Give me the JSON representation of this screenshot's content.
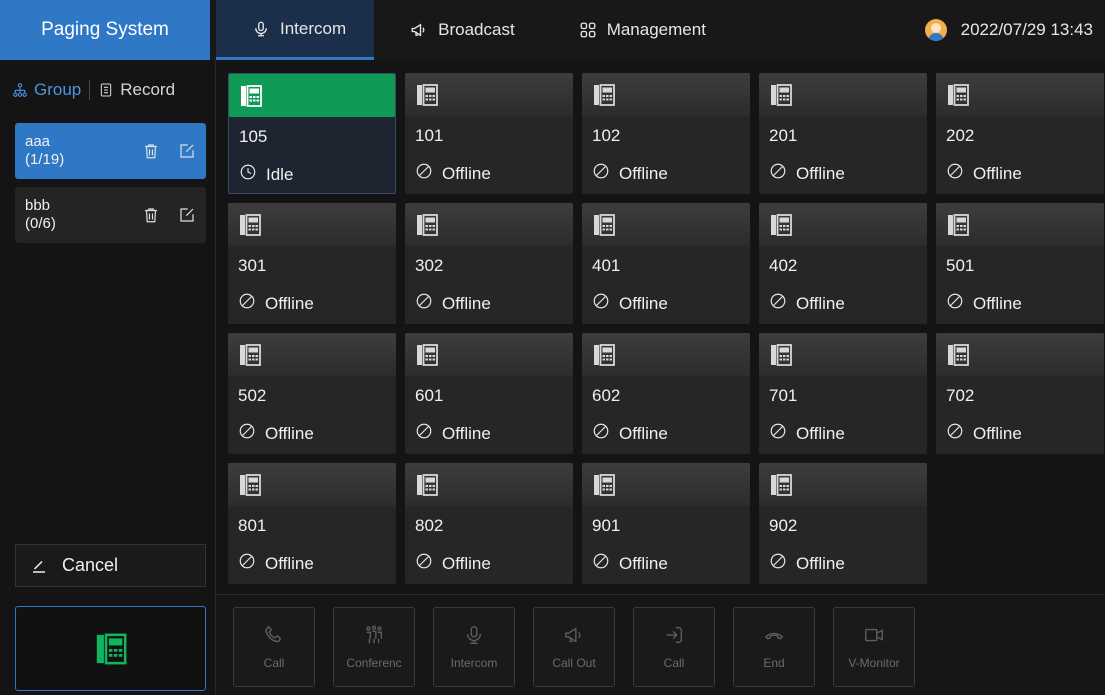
{
  "app": {
    "title": "Paging System"
  },
  "nav": {
    "tabs": [
      {
        "label": "Intercom",
        "icon": "microphone-icon",
        "active": true
      },
      {
        "label": "Broadcast",
        "icon": "megaphone-icon",
        "active": false
      },
      {
        "label": "Management",
        "icon": "grid-icon",
        "active": false
      }
    ]
  },
  "header": {
    "datetime": "2022/07/29 13:43",
    "avatar_icon": "user-avatar-icon"
  },
  "sidebar": {
    "tabs": [
      {
        "label": "Group",
        "icon": "org-chart-icon",
        "active": true
      },
      {
        "label": "Record",
        "icon": "record-list-icon",
        "active": false
      }
    ],
    "groups": [
      {
        "name": "aaa",
        "count": "(1/19)",
        "active": true
      },
      {
        "name": "bbb",
        "count": "(0/6)",
        "active": false
      }
    ],
    "cancel_label": "Cancel"
  },
  "devices": [
    {
      "number": "105",
      "status": "Idle",
      "state": "idle"
    },
    {
      "number": "101",
      "status": "Offline",
      "state": "offline"
    },
    {
      "number": "102",
      "status": "Offline",
      "state": "offline"
    },
    {
      "number": "201",
      "status": "Offline",
      "state": "offline"
    },
    {
      "number": "202",
      "status": "Offline",
      "state": "offline"
    },
    {
      "number": "301",
      "status": "Offline",
      "state": "offline"
    },
    {
      "number": "302",
      "status": "Offline",
      "state": "offline"
    },
    {
      "number": "401",
      "status": "Offline",
      "state": "offline"
    },
    {
      "number": "402",
      "status": "Offline",
      "state": "offline"
    },
    {
      "number": "501",
      "status": "Offline",
      "state": "offline"
    },
    {
      "number": "502",
      "status": "Offline",
      "state": "offline"
    },
    {
      "number": "601",
      "status": "Offline",
      "state": "offline"
    },
    {
      "number": "602",
      "status": "Offline",
      "state": "offline"
    },
    {
      "number": "701",
      "status": "Offline",
      "state": "offline"
    },
    {
      "number": "702",
      "status": "Offline",
      "state": "offline"
    },
    {
      "number": "801",
      "status": "Offline",
      "state": "offline"
    },
    {
      "number": "802",
      "status": "Offline",
      "state": "offline"
    },
    {
      "number": "901",
      "status": "Offline",
      "state": "offline"
    },
    {
      "number": "902",
      "status": "Offline",
      "state": "offline"
    }
  ],
  "actions": [
    {
      "label": "Call",
      "icon": "phone-icon"
    },
    {
      "label": "Conferenc",
      "icon": "conference-icon"
    },
    {
      "label": "Intercom",
      "icon": "microphone-icon"
    },
    {
      "label": "Call Out",
      "icon": "megaphone-icon"
    },
    {
      "label": "Call",
      "icon": "transfer-icon"
    },
    {
      "label": "End",
      "icon": "hangup-icon"
    },
    {
      "label": "V-Monitor",
      "icon": "video-icon"
    }
  ],
  "colors": {
    "brand": "#2f78c6",
    "active_device": "#0f9a55",
    "background": "#141414"
  }
}
